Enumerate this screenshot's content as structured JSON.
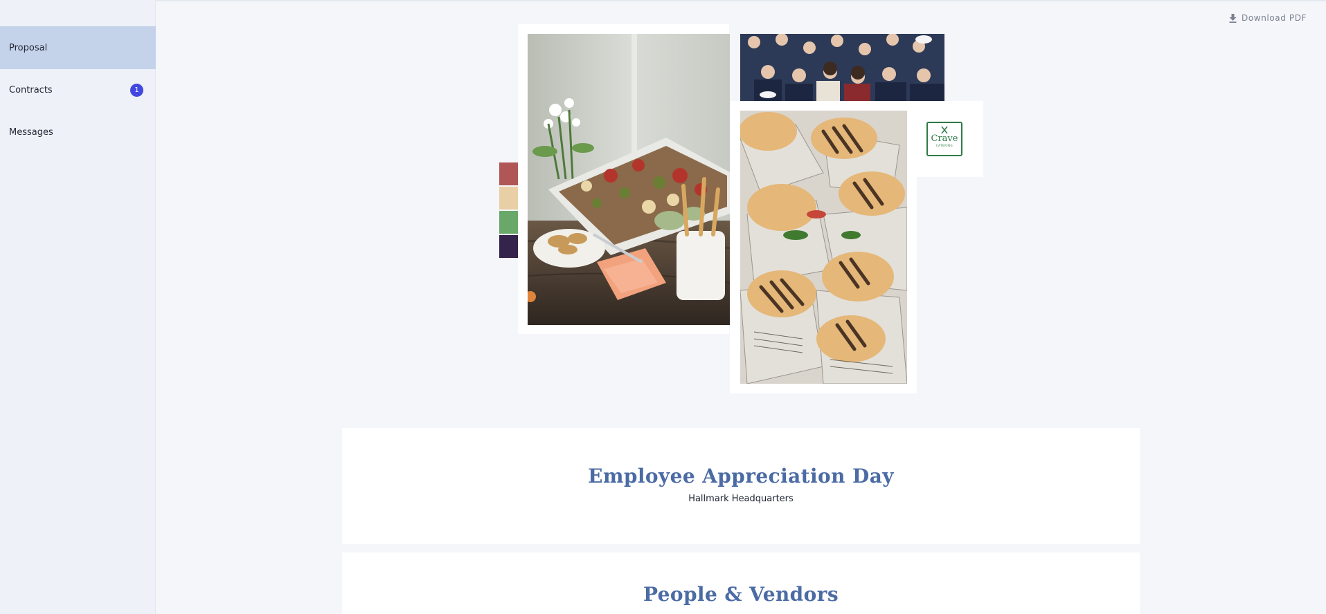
{
  "sidebar": {
    "items": [
      {
        "label": "Proposal",
        "active": true
      },
      {
        "label": "Contracts",
        "badge": "1"
      },
      {
        "label": "Messages"
      }
    ]
  },
  "toolbar": {
    "download_label": "Download PDF"
  },
  "logo": {
    "text": "Crave",
    "subtext": "CATERING"
  },
  "palette": [
    "#b15656",
    "#e8cfa5",
    "#6aa86a",
    "#34234a"
  ],
  "event": {
    "title": "Employee Appreciation Day",
    "venue": "Hallmark Headquarters"
  },
  "section2": {
    "title": "People & Vendors"
  }
}
